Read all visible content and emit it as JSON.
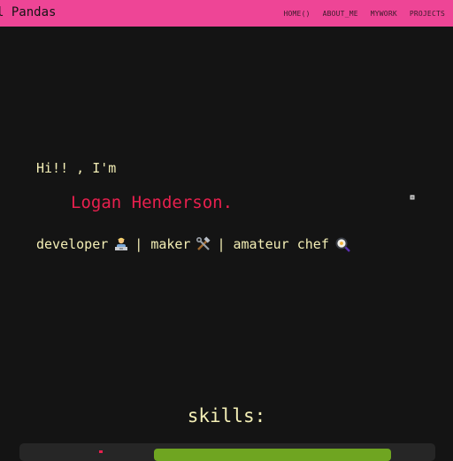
{
  "navbar": {
    "brand": "l Pandas",
    "links": [
      "HOME()",
      "ABOUT_ME",
      "MYWORK",
      "PROJECTS"
    ]
  },
  "hero": {
    "greeting": "Hi!! , I'm",
    "name": "Logan Henderson.",
    "roles": [
      "developer",
      "maker",
      "amateur chef"
    ],
    "separator": "|",
    "role_icons": [
      "developer-emoji",
      "tools-emoji",
      "frying-pan-emoji"
    ]
  },
  "skills": {
    "title": "skills:"
  },
  "colors": {
    "navbar_bg": "#ee4596",
    "page_bg": "#141414",
    "text": "#f4efb6",
    "accent": "#e8204e",
    "skill_bar": "#6fa521"
  }
}
